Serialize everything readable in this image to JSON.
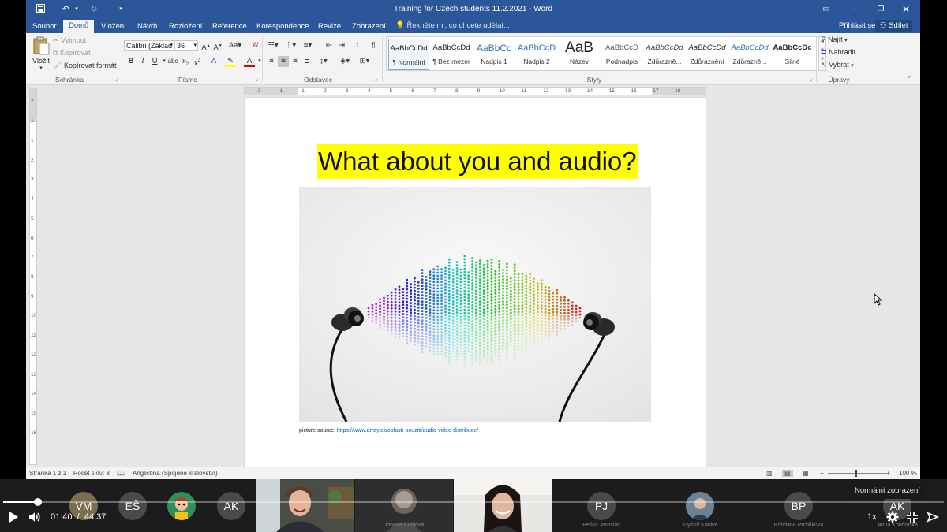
{
  "window": {
    "doc_title": "Training for Czech students 11.2.2021  -  Word",
    "signin": "Přihlásit se",
    "share": "Sdílet"
  },
  "tabs": [
    {
      "label": "Soubor"
    },
    {
      "label": "Domů"
    },
    {
      "label": "Vložení"
    },
    {
      "label": "Návrh"
    },
    {
      "label": "Rozložení"
    },
    {
      "label": "Reference"
    },
    {
      "label": "Korespondence"
    },
    {
      "label": "Revize"
    },
    {
      "label": "Zobrazení"
    }
  ],
  "tell_me": "Řekněte mi, co chcete udělat...",
  "ribbon": {
    "clipboard": {
      "paste": "Vložit",
      "cut": "Vyjmout",
      "copy": "Kopírovat",
      "format_painter": "Kopírovat formát",
      "label": "Schránka"
    },
    "font": {
      "name": "Calibri (Základ",
      "size": "36",
      "label": "Písmo"
    },
    "paragraph": {
      "label": "Odstavec"
    },
    "styles": {
      "label": "Styly",
      "items": [
        {
          "sample": "AaBbCcDd",
          "name": "¶ Normální"
        },
        {
          "sample": "AaBbCcDd",
          "name": "¶ Bez mezer"
        },
        {
          "sample": "AaBbCc",
          "name": "Nadpis 1"
        },
        {
          "sample": "AaBbCcD",
          "name": "Nadpis 2"
        },
        {
          "sample": "AaB",
          "name": "Název"
        },
        {
          "sample": "AaBbCcD",
          "name": "Podnadpis"
        },
        {
          "sample": "AaBbCcDd",
          "name": "Zdůrazně..."
        },
        {
          "sample": "AaBbCcDd",
          "name": "Zdůraznění"
        },
        {
          "sample": "AaBbCcDd",
          "name": "Zdůrazně..."
        },
        {
          "sample": "AaBbCcDc",
          "name": "Silné"
        }
      ]
    },
    "editing": {
      "find": "Najít",
      "replace": "Nahradit",
      "select": "Vybrat",
      "label": "Úpravy"
    }
  },
  "ruler": {
    "h_ticks": [
      "2",
      "1",
      "1",
      "2",
      "3",
      "4",
      "5",
      "6",
      "7",
      "8",
      "9",
      "10",
      "11",
      "12",
      "13",
      "14",
      "15",
      "16",
      "17",
      "18"
    ],
    "v_ticks": [
      "2",
      "1",
      "1",
      "2",
      "3",
      "4",
      "5",
      "6",
      "7",
      "8",
      "9",
      "10",
      "11",
      "12",
      "13",
      "14",
      "15",
      "16"
    ]
  },
  "document": {
    "heading": "What about you and audio?",
    "caption_prefix": "picture source: ",
    "caption_link": "https://www.array.cz/oblasti-pouziti/audio-video-distribuce/",
    "highlight_color": "#ffff00"
  },
  "status": {
    "page": "Stránka 1 z 1",
    "words": "Počet slov: 8",
    "language": "Angličtina (Spojené království)",
    "zoom": "100 %"
  },
  "participants": [
    {
      "initials": "VM",
      "color": "#7a6e4e"
    },
    {
      "initials": "EŠ",
      "color": "#4a4a4a"
    },
    {
      "initials": "",
      "color": "#3a3a3a",
      "icon": "avatar-cartoon"
    },
    {
      "initials": "AK",
      "color": "#4a4a4a"
    },
    {
      "name": "",
      "video": true
    },
    {
      "name": "Johana Cohlová",
      "video": true
    },
    {
      "name": "",
      "video": true
    },
    {
      "initials": "PJ",
      "name": "Peška Jaroslav",
      "color": "#4a4a4a"
    },
    {
      "initials": "",
      "name": "Kryštof Kanive",
      "color": "#3a3a3a",
      "icon": "avatar-photo"
    },
    {
      "initials": "BP",
      "name": "Bohdana Prchlíková",
      "color": "#4a4a4a"
    },
    {
      "initials": "AK",
      "name": "Anna Koufimská",
      "color": "#4a4a4a"
    }
  ],
  "player": {
    "current_time": "01:40",
    "separator": "/",
    "total_time": "44:37",
    "progress_fraction": 0.037,
    "speed": "1x",
    "tooltip": "Normální zobrazení"
  },
  "colors": {
    "word_blue": "#2b579a",
    "link": "#0563c1"
  }
}
